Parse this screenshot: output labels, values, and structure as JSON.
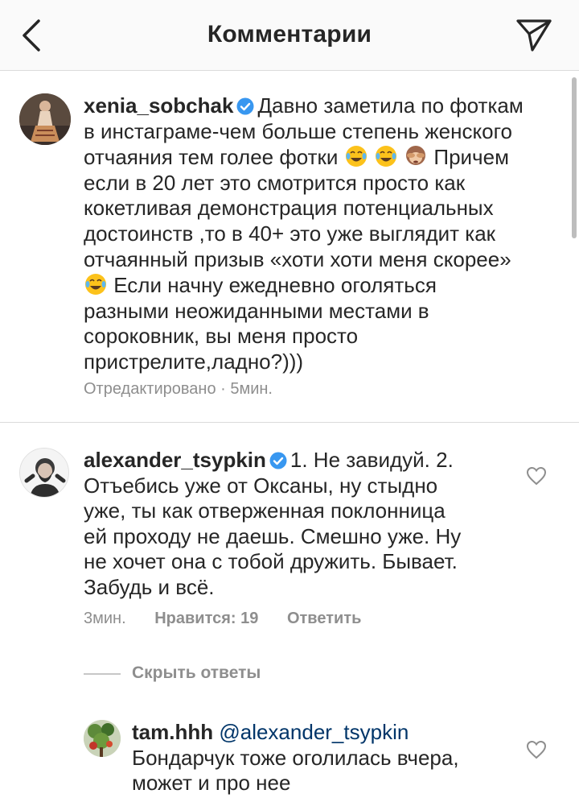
{
  "header": {
    "title": "Комментарии",
    "back_icon": "chevron-left-icon",
    "send_icon": "paper-plane-icon"
  },
  "colors": {
    "verified": "#3897f0",
    "mention": "#003569",
    "meta": "#8e8e8e",
    "divider": "#dbdbdb"
  },
  "caption": {
    "username": "xenia_sobchak",
    "text_line1": "Давно заметила по фоткам",
    "text_line2": "в инстаграме-чем больше степень женского",
    "text_line3a": "отчаяния тем голее фотки",
    "text_line3b": "Причем",
    "text_line4": "если в 20 лет это смотрится просто как",
    "text_line5": "кокетливая демонстрация потенциальных",
    "text_line6": "достоинств ,то в 40+ это уже выглядит как",
    "text_line7": "отчаянный призыв «хоти хоти меня скорее»",
    "text_line8b": "Если начну ежедневно оголяться",
    "text_line9": "разными неожиданными местами в",
    "text_line10": "сороковник, вы меня просто",
    "text_line11": "пристрелите,ладно?)))",
    "meta": "Отредактировано · 5мин."
  },
  "comments": [
    {
      "username": "alexander_tsypkin",
      "text_line1": "1. Не завидуй. 2.",
      "text_line2": "Отъебись уже от Оксаны, ну стыдно",
      "text_line3": "уже, ты как отверженная поклонница",
      "text_line4": "ей проходу не даешь. Смешно уже. Ну",
      "text_line5": "не хочет она с тобой дружить. Бывает.",
      "text_line6": "Забудь и всё.",
      "time": "3мин.",
      "likes": "Нравится: 19",
      "reply": "Ответить"
    }
  ],
  "hide_replies": "Скрыть ответы",
  "replies": [
    {
      "username": "tam.hhh",
      "mention": "@alexander_tsypkin",
      "text_line1": "Бондарчук тоже оголилась вчера,",
      "text_line2": "может и про нее"
    }
  ]
}
